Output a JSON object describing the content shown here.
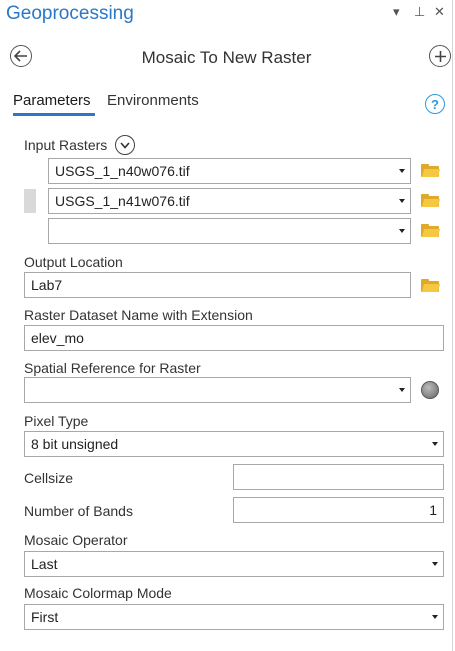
{
  "window": {
    "title": "Geoprocessing",
    "controls": {
      "menu": "▾",
      "pin": "⊥",
      "close": "✕"
    }
  },
  "tool": {
    "title": "Mosaic To New Raster",
    "back_icon": "back-arrow-circle-icon",
    "add_icon": "plus-circle-icon"
  },
  "tabs": [
    {
      "label": "Parameters",
      "active": true
    },
    {
      "label": "Environments",
      "active": false
    }
  ],
  "help_label": "?",
  "params": {
    "input_rasters": {
      "label": "Input Rasters",
      "rows": [
        "USGS_1_n40w076.tif",
        "USGS_1_n41w076.tif",
        ""
      ]
    },
    "output_location": {
      "label": "Output Location",
      "value": "Lab7"
    },
    "dataset_name": {
      "label": "Raster Dataset Name with Extension",
      "value": "elev_mo"
    },
    "spatial_reference": {
      "label": "Spatial Reference for Raster",
      "value": ""
    },
    "pixel_type": {
      "label": "Pixel Type",
      "value": "8 bit unsigned"
    },
    "cellsize": {
      "label": "Cellsize",
      "value": ""
    },
    "num_bands": {
      "label": "Number of Bands",
      "value": "1"
    },
    "mosaic_operator": {
      "label": "Mosaic Operator",
      "value": "Last"
    },
    "colormap_mode": {
      "label": "Mosaic Colormap Mode",
      "value": "First"
    }
  },
  "colors": {
    "accent": "#2b78c5",
    "folder": "#f5c842",
    "border": "#a8a8a8"
  }
}
